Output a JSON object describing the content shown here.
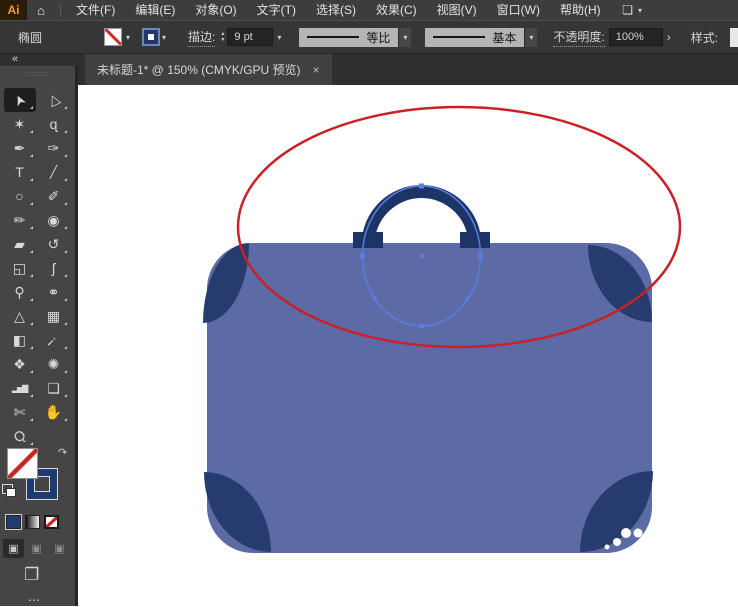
{
  "menubar": {
    "logo": "Ai",
    "home_icon": "⌂",
    "items": [
      "文件(F)",
      "编辑(E)",
      "对象(O)",
      "文字(T)",
      "选择(S)",
      "效果(C)",
      "视图(V)",
      "窗口(W)",
      "帮助(H)"
    ],
    "workspace_icon": "❏",
    "workspace_chevron": "▾"
  },
  "controlbar": {
    "context_label": "椭圆",
    "fill_chevron": "▾",
    "stroke_chevron": "▾",
    "stroke_label": "描边:",
    "stepper_up": "▴",
    "stepper_down": "▾",
    "stroke_weight": "9 pt",
    "stroke_weight_chevron": "▾",
    "width_profile_label": "等比",
    "width_profile_chevron": "▾",
    "brush_label": "基本",
    "brush_chevron": "▾",
    "opacity_label": "不透明度:",
    "opacity_value": "100%",
    "opacity_more": "›",
    "style_label": "样式:"
  },
  "tab": {
    "title": "未标题-1* @ 150% (CMYK/GPU 预览)",
    "close_icon": "×"
  },
  "toolbar": {
    "collapse_icon": "«",
    "grip": "∷∷∷∷",
    "tools": [
      {
        "name": "selection-tool",
        "glyph": "➤",
        "active": true
      },
      {
        "name": "direct-selection-tool",
        "glyph": "▷",
        "active": false
      },
      {
        "name": "magic-wand-tool",
        "glyph": "✶",
        "active": false
      },
      {
        "name": "lasso-tool",
        "glyph": "ɋ",
        "active": false
      },
      {
        "name": "pen-tool",
        "glyph": "✒",
        "active": false
      },
      {
        "name": "curvature-tool",
        "glyph": "✑",
        "active": false
      },
      {
        "name": "type-tool",
        "glyph": "T",
        "active": false
      },
      {
        "name": "line-segment-tool",
        "glyph": "╱",
        "active": false
      },
      {
        "name": "ellipse-tool",
        "glyph": "○",
        "active": false
      },
      {
        "name": "paintbrush-tool",
        "glyph": "✐",
        "active": false
      },
      {
        "name": "shaper-tool",
        "glyph": "✏",
        "active": false
      },
      {
        "name": "blob-brush-tool",
        "glyph": "◉",
        "active": false
      },
      {
        "name": "eraser-tool",
        "glyph": "▰",
        "active": false
      },
      {
        "name": "rotate-tool",
        "glyph": "↺",
        "active": false
      },
      {
        "name": "scale-tool",
        "glyph": "◱",
        "active": false
      },
      {
        "name": "width-tool",
        "glyph": "ʃ",
        "active": false
      },
      {
        "name": "puppet-warp-tool",
        "glyph": "⚲",
        "active": false
      },
      {
        "name": "shape-builder-tool",
        "glyph": "⚭",
        "active": false
      },
      {
        "name": "perspective-grid-tool",
        "glyph": "△",
        "active": false
      },
      {
        "name": "mesh-tool",
        "glyph": "▦",
        "active": false
      },
      {
        "name": "gradient-tool",
        "glyph": "◧",
        "active": false
      },
      {
        "name": "eyedropper-tool",
        "glyph": "¡",
        "active": false
      },
      {
        "name": "blend-tool",
        "glyph": "❖",
        "active": false
      },
      {
        "name": "symbol-sprayer-tool",
        "glyph": "✺",
        "active": false
      },
      {
        "name": "column-graph-tool",
        "glyph": "▂▅▇",
        "active": false
      },
      {
        "name": "artboard-tool",
        "glyph": "❏",
        "active": false
      },
      {
        "name": "slice-tool",
        "glyph": "✄",
        "active": false
      },
      {
        "name": "hand-tool",
        "glyph": "✋",
        "active": false
      },
      {
        "name": "zoom-tool",
        "glyph": "Ǫ",
        "active": false
      }
    ],
    "swap_icon": "↷",
    "draw_modes": [
      {
        "name": "draw-normal",
        "glyph": "▣"
      },
      {
        "name": "draw-behind",
        "glyph": "▣"
      },
      {
        "name": "draw-inside",
        "glyph": "▣"
      }
    ],
    "screen_mode_icon": "❐",
    "overflow_icon": "⋯"
  },
  "canvas": {
    "colors": {
      "artboard": "#ffffff",
      "body": "#5c6aa6",
      "corner": "#263c6e",
      "handle": "#1d3467",
      "selection": "#5a7de0",
      "red_ellipse": "#c92128",
      "watermark_dot": "#ffffff"
    }
  }
}
